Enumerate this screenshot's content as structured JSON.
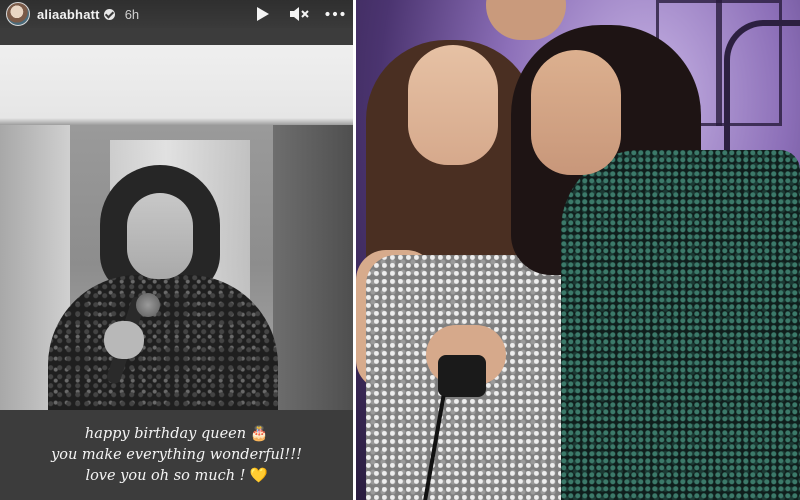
{
  "story": {
    "username": "aliaabhatt",
    "time_ago": "6h",
    "caption": {
      "line1": "happy birthday queen",
      "line1_emoji": "🎂",
      "line2": "you make everything wonderful!!!",
      "line3": "love you oh so much !",
      "line3_emoji": "💛"
    },
    "icons": {
      "verified": "verified-icon",
      "play": "play-icon",
      "mute": "mute-icon",
      "more": "more-icon"
    }
  },
  "colors": {
    "story_bg": "#3c3c3c",
    "caption_text": "#f4f4f4",
    "party_bg": "#8c6fb8"
  }
}
